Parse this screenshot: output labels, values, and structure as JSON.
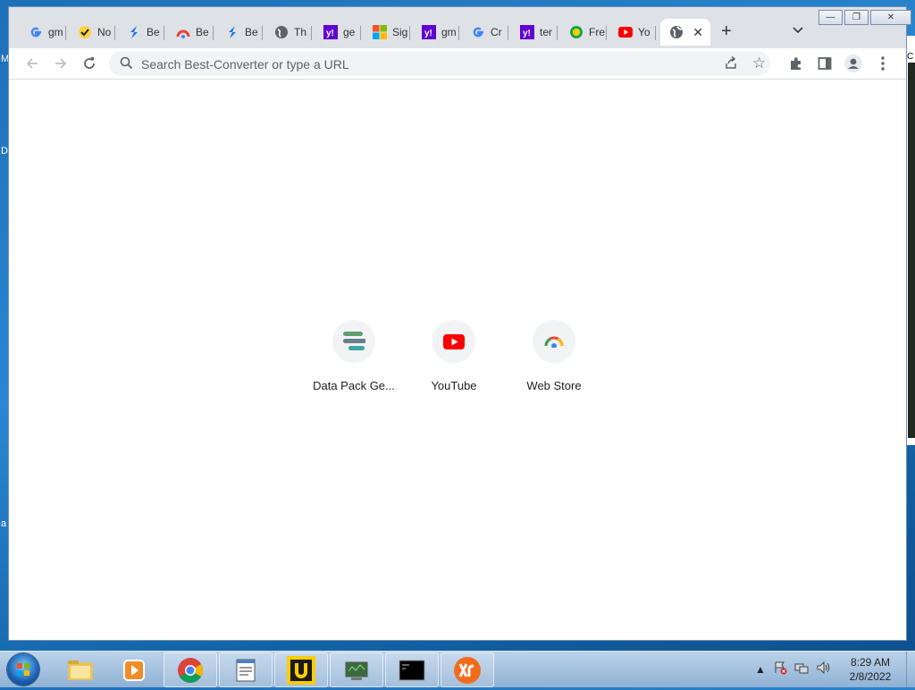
{
  "desktop": {
    "left_letters": [
      "M",
      "D",
      "a"
    ],
    "right_letter": "C"
  },
  "browser": {
    "tabs": [
      {
        "icon": "google-icon",
        "title": "gm"
      },
      {
        "icon": "checkmark-icon",
        "title": "No"
      },
      {
        "icon": "best-converter-icon",
        "title": "Be"
      },
      {
        "icon": "rainbow-icon",
        "title": "Be"
      },
      {
        "icon": "best-converter-icon",
        "title": "Be"
      },
      {
        "icon": "globe-icon",
        "title": "Th"
      },
      {
        "icon": "yahoo-icon",
        "title": "ge"
      },
      {
        "icon": "microsoft-icon",
        "title": "Sig"
      },
      {
        "icon": "yahoo-icon",
        "title": "gm"
      },
      {
        "icon": "google-icon",
        "title": "Cr"
      },
      {
        "icon": "yahoo-icon",
        "title": "ter"
      },
      {
        "icon": "green-circle-icon",
        "title": "Fre"
      },
      {
        "icon": "youtube-icon",
        "title": "Yo"
      }
    ],
    "active_tab": {
      "icon": "globe-icon",
      "title": ""
    },
    "new_tab_symbol": "+",
    "tab_list_symbol": "⌄",
    "window_buttons": {
      "minimize": "—",
      "restore": "❐",
      "close": "✕"
    },
    "omnibox": {
      "placeholder": "Search Best-Converter or type a URL",
      "value": ""
    },
    "shortcuts": [
      {
        "label": "Data Pack Ge...",
        "icon": "data-pack-icon"
      },
      {
        "label": "YouTube",
        "icon": "youtube-icon"
      },
      {
        "label": "Web Store",
        "icon": "web-store-icon"
      }
    ]
  },
  "taskbar": {
    "apps": [
      "windows-explorer-icon",
      "media-player-icon",
      "chrome-icon",
      "notepad-icon",
      "app-yellow-icon",
      "network-app-icon",
      "command-prompt-icon",
      "xr-app-icon"
    ],
    "clock_time": "8:29 AM",
    "clock_date": "2/8/2022",
    "tray_icons": [
      "show-hidden-icon",
      "action-center-icon",
      "network-icon",
      "volume-icon"
    ]
  },
  "colors": {
    "accent": "#1a73e8",
    "youtube_red": "#ff0000",
    "tab_strip": "#dee1e6",
    "yahoo_purple": "#6001d2"
  }
}
